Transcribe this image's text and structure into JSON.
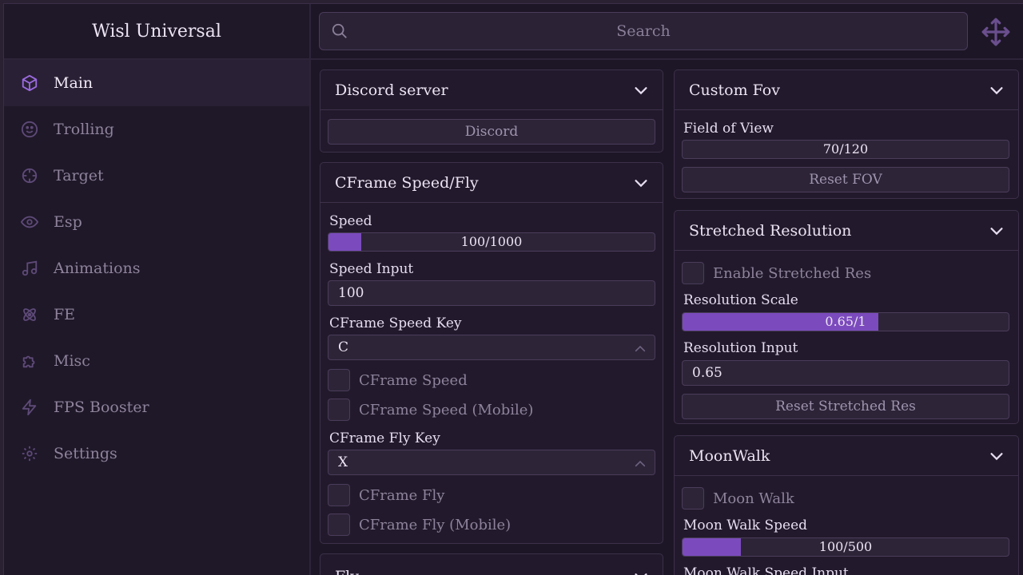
{
  "app": {
    "title": "Wisl Universal"
  },
  "sidebar": {
    "items": [
      {
        "label": "Main",
        "icon": "cube-icon"
      },
      {
        "label": "Trolling",
        "icon": "smile-icon"
      },
      {
        "label": "Target",
        "icon": "crosshair-icon"
      },
      {
        "label": "Esp",
        "icon": "eye-icon"
      },
      {
        "label": "Animations",
        "icon": "music-icon"
      },
      {
        "label": "FE",
        "icon": "atom-icon"
      },
      {
        "label": "Misc",
        "icon": "puzzle-icon"
      },
      {
        "label": "FPS Booster",
        "icon": "lightning-icon"
      },
      {
        "label": "Settings",
        "icon": "gear-icon"
      }
    ]
  },
  "search": {
    "placeholder": "Search"
  },
  "colors": {
    "accent": "#7b4bbd",
    "background": "#1d1626",
    "panel": "#221a2c"
  },
  "left": {
    "discord": {
      "title": "Discord server",
      "button": "Discord"
    },
    "cframe": {
      "title": "CFrame Speed/Fly",
      "speed_label": "Speed",
      "speed_value": "100/1000",
      "speed_fraction": 0.1,
      "speed_input_label": "Speed Input",
      "speed_input_value": "100",
      "speed_key_label": "CFrame Speed Key",
      "speed_key_value": "C",
      "check_speed": "CFrame Speed",
      "check_speed_mobile": "CFrame Speed (Mobile)",
      "fly_key_label": "CFrame Fly Key",
      "fly_key_value": "X",
      "check_fly": "CFrame Fly",
      "check_fly_mobile": "CFrame Fly (Mobile)"
    },
    "fly": {
      "title": "Fly"
    }
  },
  "right": {
    "fov": {
      "title": "Custom Fov",
      "label": "Field of View",
      "value": "70/120",
      "fraction": 0,
      "reset": "Reset FOV"
    },
    "stretched": {
      "title": "Stretched Resolution",
      "check": "Enable Stretched Res",
      "scale_label": "Resolution Scale",
      "scale_value": "0.65/1",
      "scale_fraction": 0.6,
      "input_label": "Resolution Input",
      "input_value": "0.65",
      "reset": "Reset Stretched Res"
    },
    "moonwalk": {
      "title": "MoonWalk",
      "check": "Moon Walk",
      "speed_label": "Moon Walk Speed",
      "speed_value": "100/500",
      "speed_fraction": 0.18,
      "input_label": "Moon Walk Speed Input"
    }
  }
}
